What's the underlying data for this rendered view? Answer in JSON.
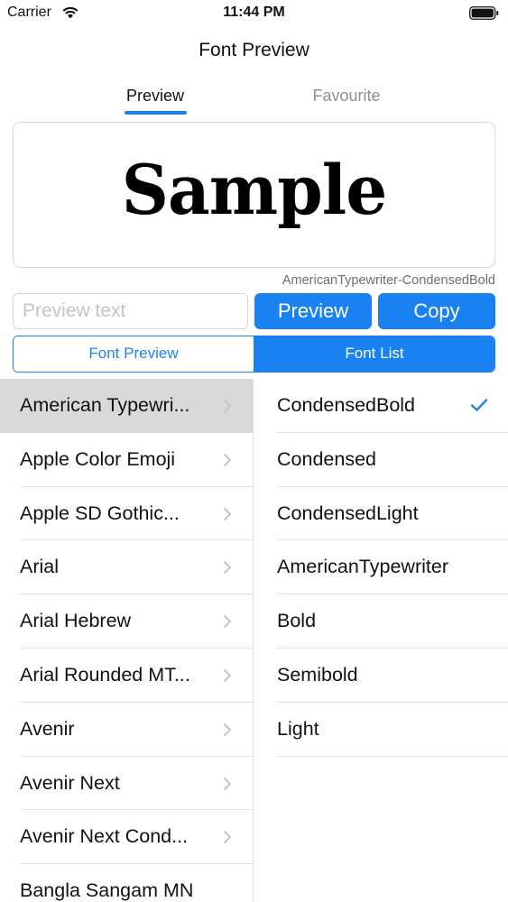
{
  "status_bar": {
    "carrier": "Carrier",
    "time": "11:44 PM",
    "icons": [
      "wifi-icon",
      "battery-icon"
    ]
  },
  "nav": {
    "title": "Font Preview",
    "tabs": [
      {
        "label": "Preview",
        "active": true
      },
      {
        "label": "Favourite",
        "active": false
      }
    ]
  },
  "preview": {
    "sample_text": "Sample",
    "font_name": "AmericanTypewriter-CondensedBold"
  },
  "controls": {
    "input_value": "",
    "input_placeholder": "Preview text",
    "preview_button": "Preview",
    "copy_button": "Copy"
  },
  "segmented": {
    "options": [
      {
        "label": "Font Preview",
        "selected": false
      },
      {
        "label": "Font List",
        "selected": true
      }
    ]
  },
  "families": [
    {
      "label": "American Typewri...",
      "selected": true
    },
    {
      "label": "Apple Color Emoji",
      "selected": false
    },
    {
      "label": "Apple SD Gothic...",
      "selected": false
    },
    {
      "label": "Arial",
      "selected": false
    },
    {
      "label": "Arial Hebrew",
      "selected": false
    },
    {
      "label": "Arial Rounded MT...",
      "selected": false
    },
    {
      "label": "Avenir",
      "selected": false
    },
    {
      "label": "Avenir Next",
      "selected": false
    },
    {
      "label": "Avenir Next Cond...",
      "selected": false
    },
    {
      "label": "Bangla Sangam MN",
      "selected": false
    }
  ],
  "styles": [
    {
      "label": "CondensedBold",
      "checked": true
    },
    {
      "label": "Condensed",
      "checked": false
    },
    {
      "label": "CondensedLight",
      "checked": false
    },
    {
      "label": "AmericanTypewriter",
      "checked": false
    },
    {
      "label": "Bold",
      "checked": false
    },
    {
      "label": "Semibold",
      "checked": false
    },
    {
      "label": "Light",
      "checked": false
    }
  ],
  "colors": {
    "accent": "#1a82f0",
    "selected_row": "#d9d9d9",
    "muted_text": "#8e8e93"
  }
}
